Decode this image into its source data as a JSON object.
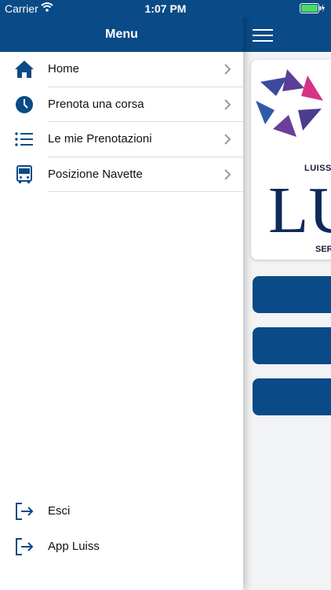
{
  "status_bar": {
    "carrier": "Carrier",
    "time": "1:07 PM"
  },
  "drawer": {
    "title": "Menu",
    "items": [
      {
        "label": "Home",
        "icon": "home-icon"
      },
      {
        "label": "Prenota una corsa",
        "icon": "clock-icon"
      },
      {
        "label": "Le mie Prenotazioni",
        "icon": "list-icon"
      },
      {
        "label": "Posizione Navette",
        "icon": "bus-icon"
      }
    ],
    "bottom_items": [
      {
        "label": "Esci",
        "icon": "logout-icon"
      },
      {
        "label": "App Luiss",
        "icon": "exit-app-icon"
      }
    ]
  },
  "main": {
    "card": {
      "top_text": "LUISS",
      "big_text": "LU",
      "bottom_text": "SER"
    }
  },
  "colors": {
    "brand_blue": "#0a4a86",
    "logo_purple": "#4b3f8f",
    "logo_pink": "#d63384"
  }
}
